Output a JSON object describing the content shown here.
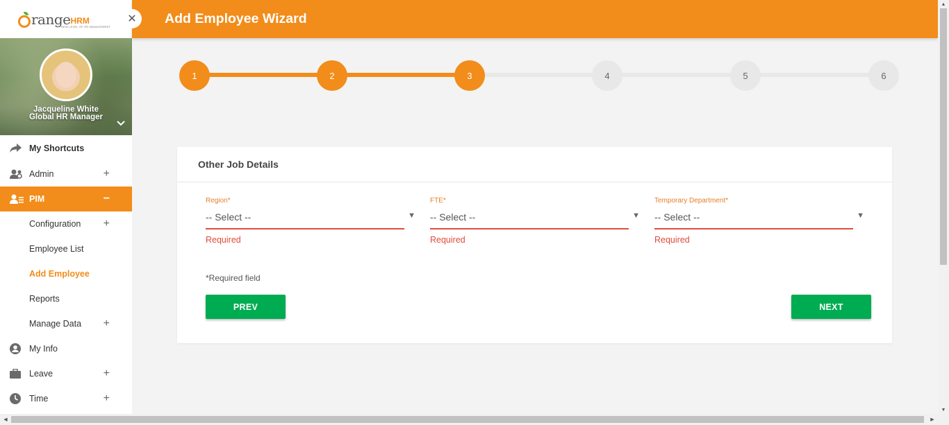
{
  "app": {
    "logo_text": "range",
    "logo_suffix": "HRM",
    "logo_tagline": "NEW LEVEL OF HR MANAGEMENT"
  },
  "user": {
    "name": "Jacqueline White",
    "role": "Global HR Manager"
  },
  "sidebar": {
    "items": [
      {
        "label": "My Shortcuts",
        "icon": "share-arrow-icon"
      },
      {
        "label": "Admin",
        "icon": "admin-users-icon",
        "expandable": true
      },
      {
        "label": "PIM",
        "icon": "pim-icon",
        "active": true,
        "expanded": true
      },
      {
        "label": "Configuration",
        "sub": true,
        "expandable": true
      },
      {
        "label": "Employee List",
        "sub": true
      },
      {
        "label": "Add Employee",
        "sub": true,
        "current": true
      },
      {
        "label": "Reports",
        "sub": true
      },
      {
        "label": "Manage Data",
        "sub": true,
        "expandable": true
      },
      {
        "label": "My Info",
        "icon": "user-circle-icon"
      },
      {
        "label": "Leave",
        "icon": "briefcase-icon",
        "expandable": true
      },
      {
        "label": "Time",
        "icon": "clock-icon",
        "expandable": true
      }
    ]
  },
  "header": {
    "title": "Add Employee Wizard"
  },
  "stepper": {
    "current_step": 3,
    "steps": [
      "1",
      "2",
      "3",
      "4",
      "5",
      "6"
    ]
  },
  "form": {
    "title": "Other Job Details",
    "fields": [
      {
        "label": "Region",
        "value": "-- Select --",
        "error": "Required"
      },
      {
        "label": "FTE",
        "value": "-- Select --",
        "error": "Required"
      },
      {
        "label": "Temporary Department",
        "value": "-- Select --",
        "error": "Required"
      }
    ],
    "required_note": "Required field",
    "required_star": "*",
    "prev_label": "PREV",
    "next_label": "NEXT"
  },
  "colors": {
    "brand": "#f28c1a",
    "button_green": "#00ac52",
    "error_red": "#e04a3c"
  }
}
